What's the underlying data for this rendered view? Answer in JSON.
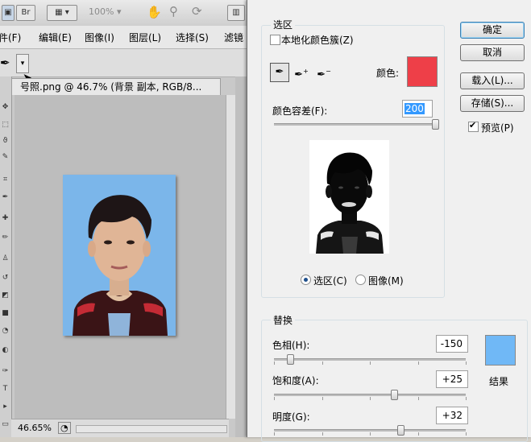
{
  "photoshop": {
    "topbar": {
      "br_label": "Br",
      "zoom": "100%"
    },
    "menus": [
      "件(F)",
      "编辑(E)",
      "图像(I)",
      "图层(L)",
      "选择(S)",
      "滤镜"
    ],
    "document_tab": "号照.png @ 46.7% (背景 副本, RGB/8...",
    "status_zoom": "46.65%"
  },
  "dialog": {
    "selection_group": {
      "title": "选区",
      "localized_label": "本地化颜色簇(Z)",
      "localized_checked": false,
      "color_label": "颜色:",
      "color_swatch": "#ee3f48",
      "fuzziness_label": "颜色容差(F):",
      "fuzziness_value": "200",
      "fuzziness_level": 1.0,
      "radio_selection": "选区(C)",
      "radio_image": "图像(M)",
      "selected_radio": "选区(C)"
    },
    "buttons": {
      "ok": "确定",
      "cancel": "取消",
      "load": "载入(L)...",
      "save": "存储(S)...",
      "preview_label": "预览(P)",
      "preview_checked": true
    },
    "replace_group": {
      "title": "替换",
      "hue_label": "色相(H):",
      "hue_value": "-150",
      "hue_range": [
        -180,
        180
      ],
      "saturation_label": "饱和度(A):",
      "saturation_value": "+25",
      "saturation_range": [
        -100,
        100
      ],
      "lightness_label": "明度(G):",
      "lightness_value": "+32",
      "lightness_range": [
        -100,
        100
      ],
      "result_label": "结果",
      "result_swatch": "#70b8f6"
    }
  }
}
